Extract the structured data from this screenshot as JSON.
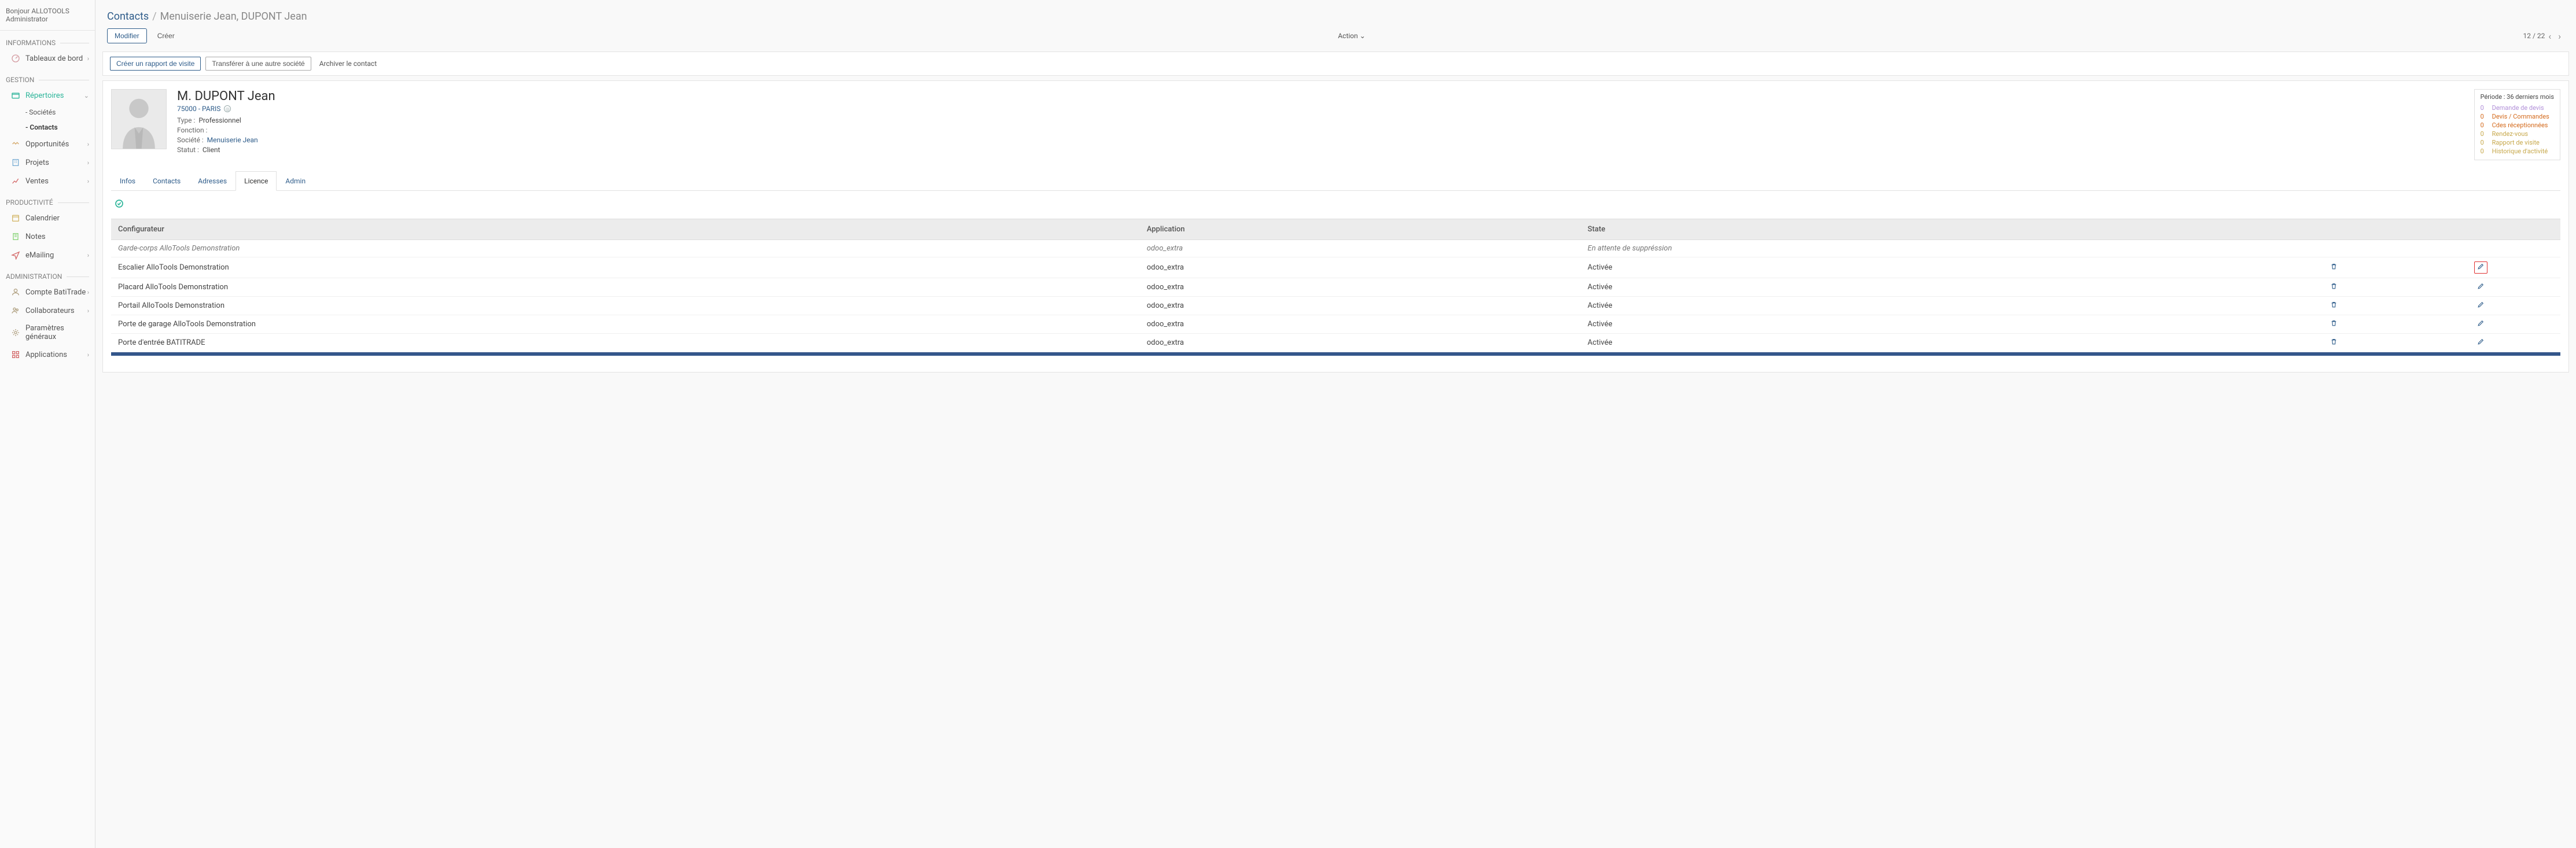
{
  "greeting": "Bonjour ALLOTOOLS Administrator",
  "sections": {
    "informations": "INFORMATIONS",
    "gestion": "GESTION",
    "productivite": "PRODUCTIVITÉ",
    "administration": "ADMINISTRATION"
  },
  "nav": {
    "dashboards": "Tableaux de bord",
    "repertoires": "Répertoires",
    "societes": "- Sociétés",
    "contacts": "- Contacts",
    "opportunites": "Opportunités",
    "projets": "Projets",
    "ventes": "Ventes",
    "calendrier": "Calendrier",
    "notes": "Notes",
    "emailing": "eMailing",
    "compte": "Compte BatiTrade",
    "collaborateurs": "Collaborateurs",
    "parametres": "Paramètres généraux",
    "applications": "Applications"
  },
  "breadcrumb": {
    "root": "Contacts",
    "current": "Menuiserie Jean, DUPONT Jean"
  },
  "controls": {
    "modify": "Modifier",
    "create": "Créer",
    "action": "Action",
    "page_pos": "12 / 22"
  },
  "actions": {
    "visit_report": "Créer un rapport de visite",
    "transfer": "Transférer à une autre société",
    "archive": "Archiver le contact"
  },
  "profile": {
    "name": "M. DUPONT Jean",
    "location": "75000 - PARIS",
    "type_label": "Type :",
    "type_value": "Professionnel",
    "fonction_label": "Fonction :",
    "fonction_value": "",
    "societe_label": "Société :",
    "societe_value": "Menuiserie Jean",
    "statut_label": "Statut :",
    "statut_value": "Client"
  },
  "stats": {
    "period": "Période : 36 derniers mois",
    "items": [
      {
        "count": "0",
        "label": "Demande de devis",
        "color": "#b08ed8"
      },
      {
        "count": "0",
        "label": "Devis / Commandes",
        "color": "#d46a1c"
      },
      {
        "count": "0",
        "label": "Cdes réceptionnées",
        "color": "#d46a1c"
      },
      {
        "count": "0",
        "label": "Rendez-vous",
        "color": "#c7a84b"
      },
      {
        "count": "0",
        "label": "Rapport de visite",
        "color": "#c7a84b"
      },
      {
        "count": "0",
        "label": "Historique d'activité",
        "color": "#c7a84b"
      }
    ]
  },
  "tabs": {
    "infos": "Infos",
    "contacts": "Contacts",
    "adresses": "Adresses",
    "licence": "Licence",
    "admin": "Admin"
  },
  "licence_table": {
    "headers": {
      "config": "Configurateur",
      "app": "Application",
      "state": "State"
    },
    "rows": [
      {
        "config": "Garde-corps AlloTools Demonstration",
        "app": "odoo_extra",
        "state": "En attente de suppréssion",
        "pending": true,
        "highlight_edit": false
      },
      {
        "config": "Escalier AlloTools Demonstration",
        "app": "odoo_extra",
        "state": "Activée",
        "pending": false,
        "highlight_edit": true
      },
      {
        "config": "Placard AlloTools Demonstration",
        "app": "odoo_extra",
        "state": "Activée",
        "pending": false,
        "highlight_edit": false
      },
      {
        "config": "Portail AlloTools Demonstration",
        "app": "odoo_extra",
        "state": "Activée",
        "pending": false,
        "highlight_edit": false
      },
      {
        "config": "Porte de garage AlloTools Demonstration",
        "app": "odoo_extra",
        "state": "Activée",
        "pending": false,
        "highlight_edit": false
      },
      {
        "config": "Porte d'entrée BATITRADE",
        "app": "odoo_extra",
        "state": "Activée",
        "pending": false,
        "highlight_edit": false
      }
    ]
  }
}
